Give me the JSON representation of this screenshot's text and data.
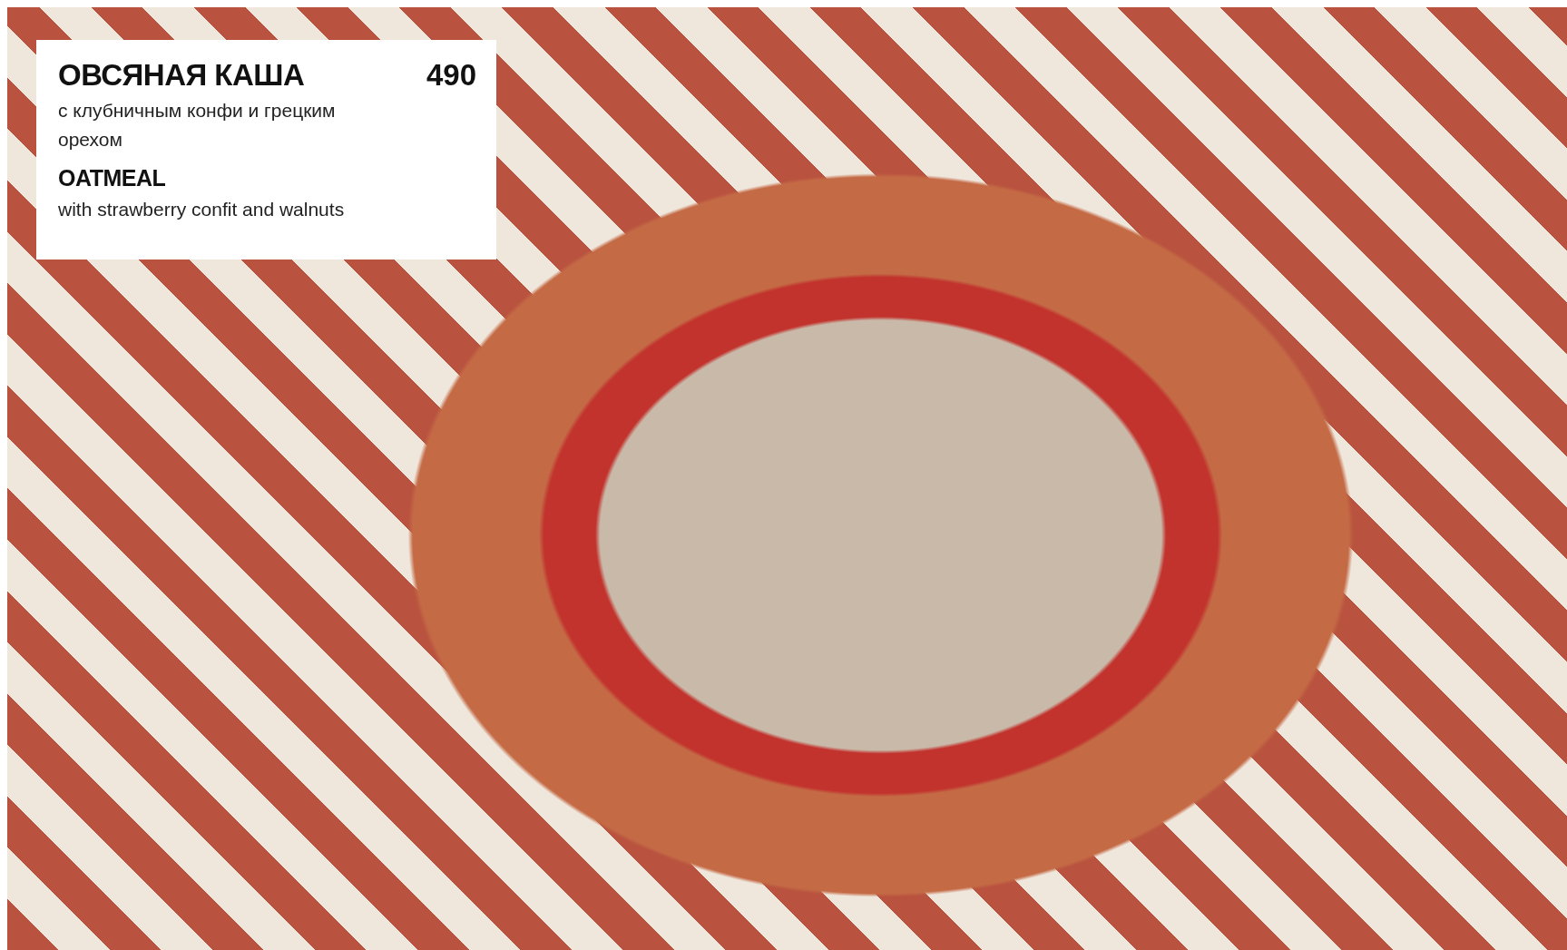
{
  "menu_item": {
    "title_ru": "ОВСЯНАЯ КАША",
    "price": "490",
    "description_ru": "с клубничным конфи и грецким орехом",
    "title_en": "OATMEAL",
    "description_en": "with strawberry confit and walnuts"
  }
}
